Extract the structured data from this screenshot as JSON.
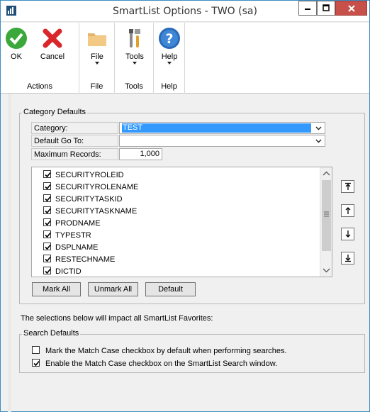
{
  "window": {
    "title": "SmartList Options  -  TWO (sa)",
    "accent": "#3c8ec4",
    "close_color": "#c7504b"
  },
  "ribbon": {
    "groups": [
      {
        "label": "Actions",
        "buttons": [
          {
            "label": "OK",
            "icon": "check-icon"
          },
          {
            "label": "Cancel",
            "icon": "close-x-icon"
          }
        ]
      },
      {
        "label": "File",
        "buttons": [
          {
            "label": "File",
            "icon": "folder-icon"
          }
        ]
      },
      {
        "label": "Tools",
        "buttons": [
          {
            "label": "Tools",
            "icon": "tools-icon"
          }
        ]
      },
      {
        "label": "Help",
        "buttons": [
          {
            "label": "Help",
            "icon": "help-icon"
          }
        ]
      }
    ]
  },
  "category_defaults": {
    "title": "Category Defaults",
    "category_label": "Category:",
    "category_value": "TEST",
    "goto_label": "Default Go To:",
    "goto_value": "",
    "max_records_label": "Maximum Records:",
    "max_records_value": "1,000",
    "fields": [
      "SECURITYROLEID",
      "SECURITYROLENAME",
      "SECURITYTASKID",
      "SECURITYTASKNAME",
      "PRODNAME",
      "TYPESTR",
      "DSPLNAME",
      "RESTECHNAME",
      "DICTID"
    ],
    "mark_all_label": "Mark All",
    "unmark_all_label": "Unmark All",
    "default_label": "Default"
  },
  "favorites_note": "The selections below will impact all SmartList Favorites:",
  "search_defaults": {
    "title": "Search Defaults",
    "option1_label": "Mark the Match Case checkbox by default when performing searches.",
    "option1_checked": false,
    "option2_label": "Enable the Match Case checkbox on the SmartList Search window.",
    "option2_checked": true
  }
}
